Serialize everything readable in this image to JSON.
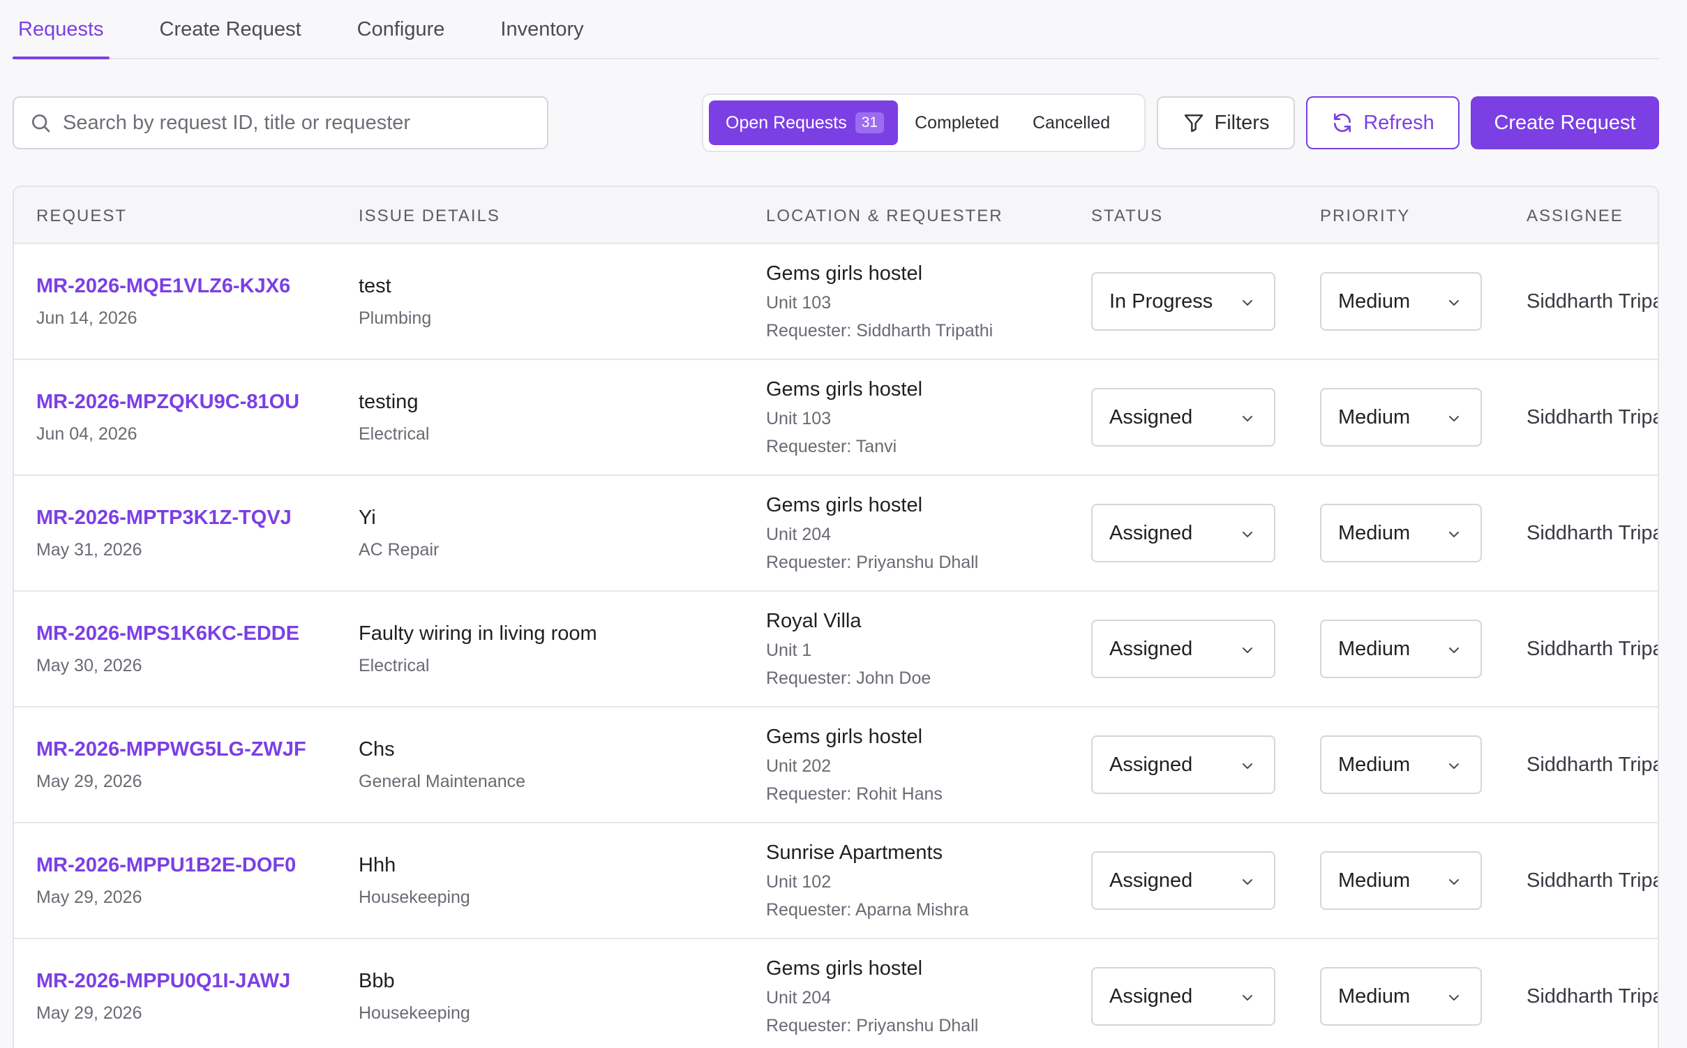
{
  "tabs": [
    {
      "label": "Requests",
      "active": true
    },
    {
      "label": "Create Request",
      "active": false
    },
    {
      "label": "Configure",
      "active": false
    },
    {
      "label": "Inventory",
      "active": false
    }
  ],
  "search": {
    "placeholder": "Search by request ID, title or requester",
    "value": ""
  },
  "segments": {
    "open": {
      "label": "Open Requests",
      "count": "31"
    },
    "completed": {
      "label": "Completed"
    },
    "cancelled": {
      "label": "Cancelled"
    }
  },
  "buttons": {
    "filters": "Filters",
    "refresh": "Refresh",
    "create": "Create Request"
  },
  "colors": {
    "accent": "#7b3fe4"
  },
  "table": {
    "headers": [
      "REQUEST",
      "ISSUE DETAILS",
      "LOCATION & REQUESTER",
      "STATUS",
      "PRIORITY",
      "ASSIGNEE"
    ],
    "rows": [
      {
        "id": "MR-2026-MQE1VLZ6-KJX6",
        "date": "Jun 14, 2026",
        "title": "test",
        "category": "Plumbing",
        "property": "Gems girls hostel",
        "unit": "Unit 103",
        "requester": "Requester: Siddharth Tripathi",
        "status": "In Progress",
        "priority": "Medium",
        "assignee": "Siddharth Tripathi"
      },
      {
        "id": "MR-2026-MPZQKU9C-81OU",
        "date": "Jun 04, 2026",
        "title": "testing",
        "category": "Electrical",
        "property": "Gems girls hostel",
        "unit": "Unit 103",
        "requester": "Requester: Tanvi",
        "status": "Assigned",
        "priority": "Medium",
        "assignee": "Siddharth Tripathi"
      },
      {
        "id": "MR-2026-MPTP3K1Z-TQVJ",
        "date": "May 31, 2026",
        "title": "Yi",
        "category": "AC Repair",
        "property": "Gems girls hostel",
        "unit": "Unit 204",
        "requester": "Requester: Priyanshu Dhall",
        "status": "Assigned",
        "priority": "Medium",
        "assignee": "Siddharth Tripathi"
      },
      {
        "id": "MR-2026-MPS1K6KC-EDDE",
        "date": "May 30, 2026",
        "title": "Faulty wiring in living room",
        "category": "Electrical",
        "property": "Royal Villa",
        "unit": "Unit 1",
        "requester": "Requester: John Doe",
        "status": "Assigned",
        "priority": "Medium",
        "assignee": "Siddharth Tripathi"
      },
      {
        "id": "MR-2026-MPPWG5LG-ZWJF",
        "date": "May 29, 2026",
        "title": "Chs",
        "category": "General Maintenance",
        "property": "Gems girls hostel",
        "unit": "Unit 202",
        "requester": "Requester: Rohit Hans",
        "status": "Assigned",
        "priority": "Medium",
        "assignee": "Siddharth Tripathi"
      },
      {
        "id": "MR-2026-MPPU1B2E-DOF0",
        "date": "May 29, 2026",
        "title": "Hhh",
        "category": "Housekeeping",
        "property": "Sunrise Apartments",
        "unit": "Unit 102",
        "requester": "Requester: Aparna Mishra",
        "status": "Assigned",
        "priority": "Medium",
        "assignee": "Siddharth Tripathi"
      },
      {
        "id": "MR-2026-MPPU0Q1I-JAWJ",
        "date": "May 29, 2026",
        "title": "Bbb",
        "category": "Housekeeping",
        "property": "Gems girls hostel",
        "unit": "Unit 204",
        "requester": "Requester: Priyanshu Dhall",
        "status": "Assigned",
        "priority": "Medium",
        "assignee": "Siddharth Tripathi"
      }
    ]
  }
}
